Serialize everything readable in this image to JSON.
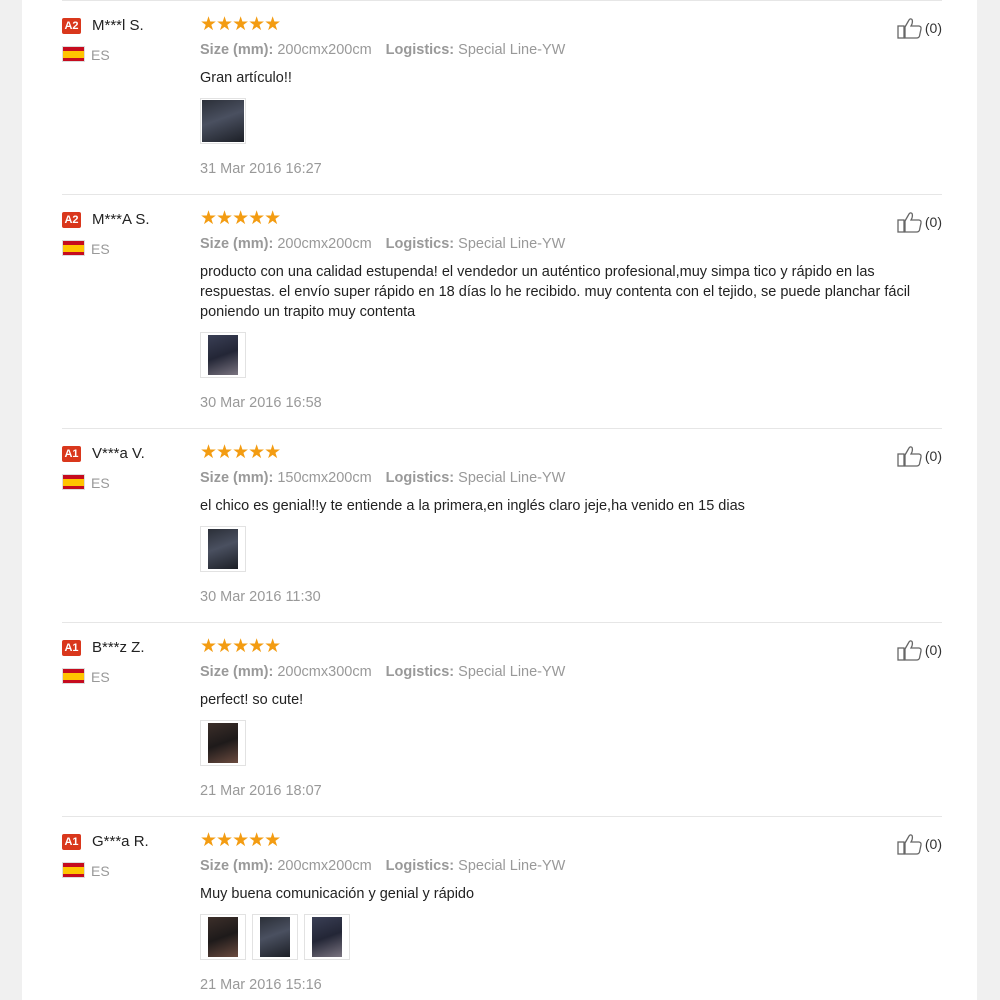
{
  "reviews": [
    {
      "badge": "A2",
      "username": "M***l S.",
      "country": "ES",
      "stars": "★★★★★",
      "size_label": "Size (mm):",
      "size_value": "200cmx200cm",
      "logistics_label": "Logistics:",
      "logistics_value": "Special Line-YW",
      "text": "Gran artículo!!",
      "date": "31 Mar 2016 16:27",
      "likes": "(0)"
    },
    {
      "badge": "A2",
      "username": "M***A S.",
      "country": "ES",
      "stars": "★★★★★",
      "size_label": "Size (mm):",
      "size_value": "200cmx200cm",
      "logistics_label": "Logistics:",
      "logistics_value": "Special Line-YW",
      "text": "producto con una calidad estupenda! el vendedor un auténtico profesional,muy simpa tico y rápido en las respuestas. el envío super rápido en 18 días lo he recibido. muy contenta con el tejido, se puede planchar fácil poniendo un trapito muy contenta",
      "date": "30 Mar 2016 16:58",
      "likes": "(0)"
    },
    {
      "badge": "A1",
      "username": "V***a V.",
      "country": "ES",
      "stars": "★★★★★",
      "size_label": "Size (mm):",
      "size_value": "150cmx200cm",
      "logistics_label": "Logistics:",
      "logistics_value": "Special Line-YW",
      "text": "el chico es genial!!y te entiende a la primera,en inglés claro jeje,ha venido en 15 dias",
      "date": "30 Mar 2016 11:30",
      "likes": "(0)"
    },
    {
      "badge": "A1",
      "username": "B***z Z.",
      "country": "ES",
      "stars": "★★★★★",
      "size_label": "Size (mm):",
      "size_value": "200cmx300cm",
      "logistics_label": "Logistics:",
      "logistics_value": "Special Line-YW",
      "text": "perfect! so cute!",
      "date": "21 Mar 2016 18:07",
      "likes": "(0)"
    },
    {
      "badge": "A1",
      "username": "G***a R.",
      "country": "ES",
      "stars": "★★★★★",
      "size_label": "Size (mm):",
      "size_value": "200cmx200cm",
      "logistics_label": "Logistics:",
      "logistics_value": "Special Line-YW",
      "text": "Muy buena comunicación y genial y rápido",
      "date": "21 Mar 2016 15:16",
      "likes": "(0)"
    }
  ],
  "icons": {
    "flag": "spain-flag-icon",
    "like": "thumbs-up-icon",
    "rating": "star-icon"
  },
  "colors": {
    "badge": "#d9371c",
    "stars": "#f39c12",
    "muted_text": "#999999"
  }
}
